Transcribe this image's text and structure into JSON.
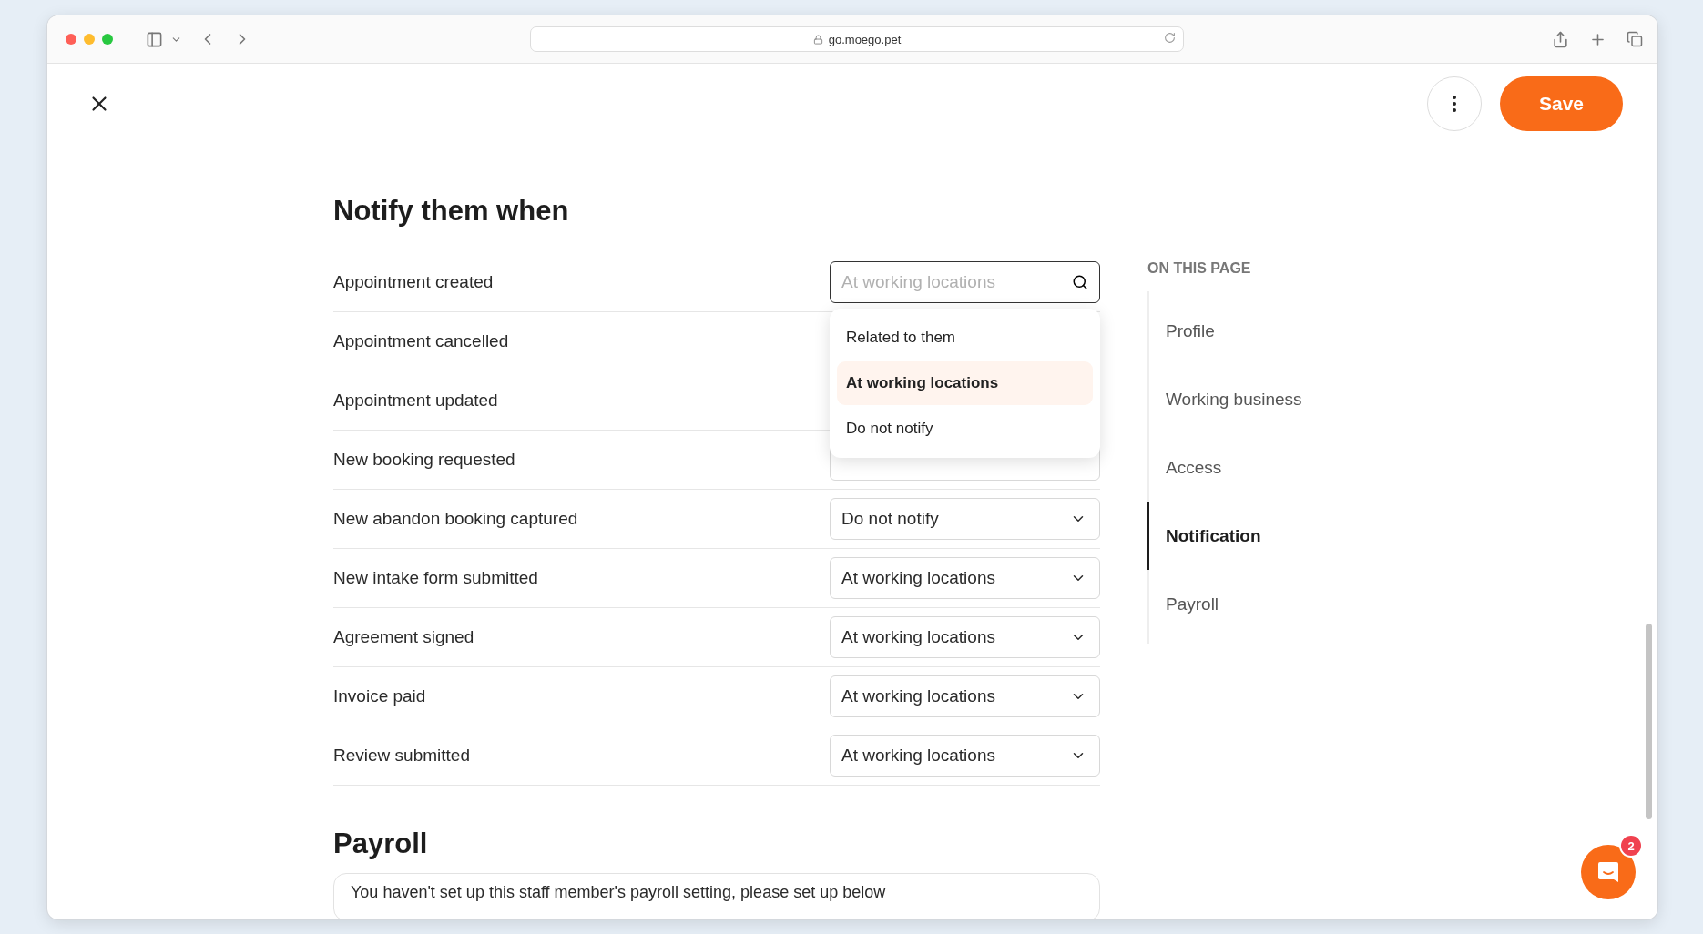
{
  "browser": {
    "url": "go.moego.pet"
  },
  "header": {
    "save_label": "Save"
  },
  "notify": {
    "title": "Notify them when",
    "rows": [
      {
        "label": "Appointment created",
        "kind": "search",
        "placeholder": "At working locations"
      },
      {
        "label": "Appointment cancelled",
        "kind": "covered"
      },
      {
        "label": "Appointment updated",
        "kind": "covered"
      },
      {
        "label": "New booking requested",
        "kind": "covered"
      },
      {
        "label": "New abandon booking captured",
        "kind": "select",
        "value": "Do not notify"
      },
      {
        "label": "New intake form submitted",
        "kind": "select",
        "value": "At working locations"
      },
      {
        "label": "Agreement signed",
        "kind": "select",
        "value": "At working locations"
      },
      {
        "label": "Invoice paid",
        "kind": "select",
        "value": "At working locations"
      },
      {
        "label": "Review submitted",
        "kind": "select",
        "value": "At working locations"
      }
    ],
    "dropdown": [
      {
        "label": "Related to them",
        "selected": false
      },
      {
        "label": "At working locations",
        "selected": true
      },
      {
        "label": "Do not notify",
        "selected": false
      }
    ]
  },
  "payroll": {
    "title": "Payroll",
    "notice": "You haven't set up this staff member's payroll setting, please set up below"
  },
  "on_this_page": {
    "title": "ON THIS PAGE",
    "items": [
      {
        "label": "Profile",
        "selected": false
      },
      {
        "label": "Working business",
        "selected": false
      },
      {
        "label": "Access",
        "selected": false
      },
      {
        "label": "Notification",
        "selected": true
      },
      {
        "label": "Payroll",
        "selected": false
      }
    ]
  },
  "chat": {
    "badge": "2"
  }
}
